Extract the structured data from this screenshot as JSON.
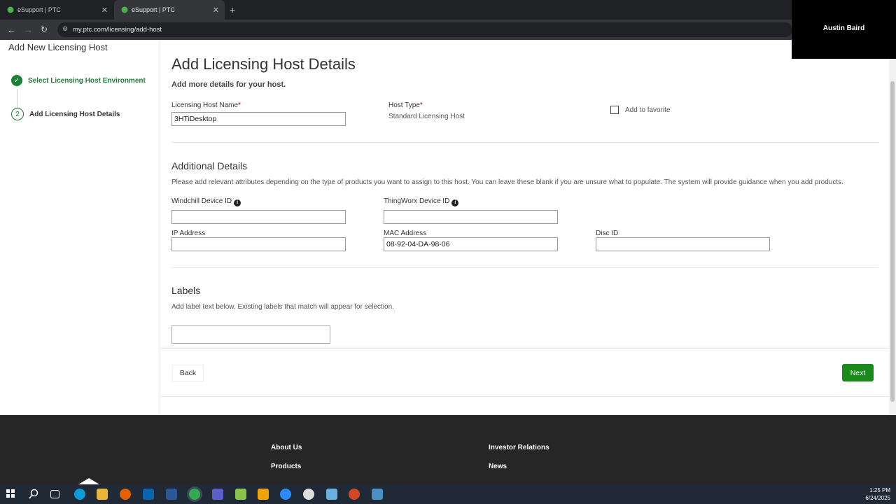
{
  "browser": {
    "tabs": [
      {
        "title": "eSupport | PTC"
      },
      {
        "title": "eSupport | PTC"
      }
    ],
    "url": "my.ptc.com/licensing/add-host"
  },
  "video_overlay": {
    "name": "Austin Baird"
  },
  "sidebar": {
    "title": "Add New Licensing Host",
    "steps": [
      {
        "number": "1",
        "label": "Select Licensing Host Environment",
        "status": "complete"
      },
      {
        "number": "2",
        "label": "Add Licensing Host Details",
        "status": "current"
      }
    ]
  },
  "form": {
    "title": "Add Licensing Host Details",
    "subtitle": "Add more details for your host.",
    "host_name_label": "Licensing Host Name",
    "host_name_value": "3HTiDesktop",
    "host_type_label": "Host Type",
    "host_type_value": "Standard Licensing Host",
    "favorite_label": "Add to favorite",
    "required_mark": "*",
    "additional": {
      "title": "Additional Details",
      "description": "Please add relevant attributes depending on the type of products you want to assign to this host. You can leave these blank if you are unsure what to populate. The system will provide guidance when you add products.",
      "windchill_label": "Windchill Device ID",
      "windchill_value": "",
      "thingworx_label": "ThingWorx Device ID",
      "thingworx_value": "",
      "ip_label": "IP Address",
      "ip_value": "",
      "mac_label": "MAC Address",
      "mac_value": "08-92-04-DA-98-06",
      "disc_label": "Disc ID",
      "disc_value": ""
    },
    "labels": {
      "title": "Labels",
      "description": "Add label text below. Existing labels that match will appear for selection.",
      "value": ""
    },
    "back_label": "Back",
    "next_label": "Next"
  },
  "site_footer": {
    "links": [
      "About Us",
      "Products",
      "Investor Relations",
      "News"
    ]
  },
  "taskbar": {
    "time": "1:25 PM",
    "date": "6/24/2025"
  },
  "colors": {
    "accent_green": "#1a8a1a",
    "step_green": "#1a7f37",
    "footer_bg": "#262626"
  }
}
